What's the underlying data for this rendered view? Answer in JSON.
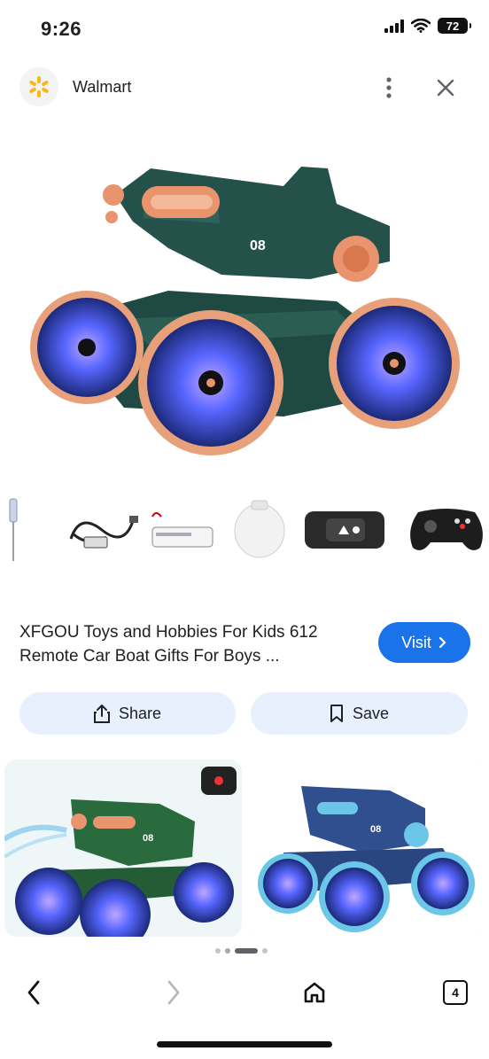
{
  "status_bar": {
    "time": "9:26",
    "battery": "72"
  },
  "header": {
    "site_name": "Walmart"
  },
  "product": {
    "title": "XFGOU Toys and Hobbies For Kids 612 Remote Car Boat Gifts For Boys ...",
    "visit_label": "Visit",
    "hero_badge": "08"
  },
  "actions": {
    "share_label": "Share",
    "save_label": "Save"
  },
  "related": {
    "left_badge": "08",
    "right_badge": "08"
  },
  "bottom_nav": {
    "tab_count": "4"
  },
  "colors": {
    "accent": "#1a73e8",
    "chip": "#e8f0fe",
    "tank_green": "#24524a",
    "tank_orange": "#e9946d",
    "wheel_glow": "#5b6cff"
  }
}
